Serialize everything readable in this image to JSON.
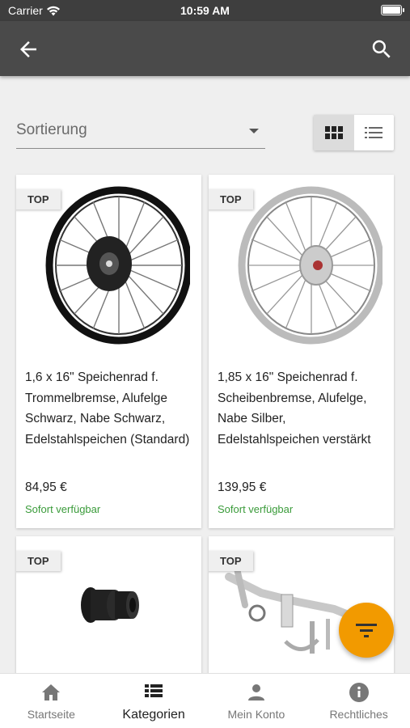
{
  "statusbar": {
    "carrier": "Carrier",
    "time": "10:59 AM"
  },
  "appbar": {
    "back_icon": "arrow-back-icon",
    "search_icon": "search-icon"
  },
  "sort": {
    "label": "Sortierung"
  },
  "view_toggle": {
    "grid_icon": "grid-view-icon",
    "list_icon": "list-view-icon",
    "active": "grid"
  },
  "products": [
    {
      "badge": "TOP",
      "title": "1,6 x 16\" Speichenrad f. Trommelbremse, Alufelge Schwarz, Nabe Schwarz, Edelstahlspeichen (Standard)",
      "price": "84,95 €",
      "stock": "Sofort verfügbar",
      "image": "black-spoke-wheel"
    },
    {
      "badge": "TOP",
      "title": "1,85 x 16\" Speichenrad f. Scheibenbremse, Alufelge, Nabe Silber, Edelstahlspeichen verstärkt",
      "price": "139,95 €",
      "stock": "Sofort verfügbar",
      "image": "silver-spoke-wheel"
    },
    {
      "badge": "TOP",
      "image": "rubber-sleeve"
    },
    {
      "badge": "TOP",
      "image": "chrome-parts-kit"
    }
  ],
  "fab": {
    "icon": "filter-icon"
  },
  "bottom_nav": [
    {
      "label": "Startseite",
      "icon": "home-icon"
    },
    {
      "label": "Kategorien",
      "icon": "categories-icon",
      "active": true
    },
    {
      "label": "Mein Konto",
      "icon": "person-icon"
    },
    {
      "label": "Rechtliches",
      "icon": "info-icon"
    }
  ],
  "colors": {
    "appbar": "#4a4a4a",
    "accent": "#f29a00",
    "stock_green": "#3a9b3a"
  }
}
